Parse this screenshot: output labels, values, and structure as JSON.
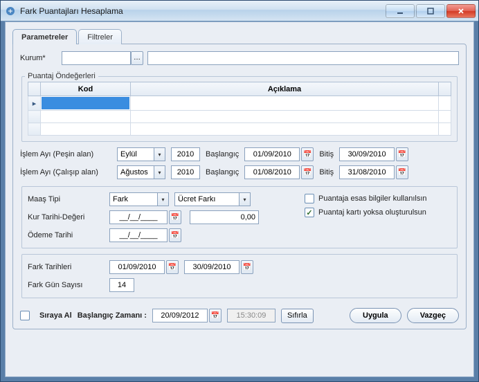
{
  "window": {
    "title": "Fark Puantajları Hesaplama"
  },
  "tabs": {
    "parametreler": "Parametreler",
    "filtreler": "Filtreler"
  },
  "kurum": {
    "label": "Kurum*",
    "code": "",
    "desc": ""
  },
  "puantaj_group": {
    "title": "Puantaj Öndeğerleri",
    "col_kod": "Kod",
    "col_aciklama": "Açıklama"
  },
  "islem": {
    "pesin_label": "İşlem Ayı (Peşin alan)",
    "calisip_label": "İşlem Ayı (Çalışıp alan)",
    "ay_pesin": "Eylül",
    "yil_pesin": "2010",
    "ay_calisip": "Ağustos",
    "yil_calisip": "2010",
    "baslangic_label": "Başlangıç",
    "bitis_label": "Bitiş",
    "pesin_baslangic": "01/09/2010",
    "pesin_bitis": "30/09/2010",
    "calisip_baslangic": "01/08/2010",
    "calisip_bitis": "31/08/2010"
  },
  "maas": {
    "tipi_label": "Maaş Tipi",
    "tipi_value": "Fark",
    "ucret_value": "Ücret Farkı",
    "kur_label": "Kur Tarihi-Değeri",
    "kur_tarih": "__/__/____",
    "kur_deger": "0,00",
    "odeme_label": "Ödeme Tarihi",
    "odeme_value": "__/__/____",
    "cb1_label": "Puantaja esas bilgiler kullanılsın",
    "cb2_label": "Puantaj kartı yoksa oluşturulsun"
  },
  "fark": {
    "tarihleri_label": "Fark Tarihleri",
    "t1": "01/09/2010",
    "t2": "30/09/2010",
    "gun_label": "Fark Gün Sayısı",
    "gun_value": "14"
  },
  "footer": {
    "siraya_label": "Sıraya Al",
    "baslangic_label": "Başlangıç Zamanı :",
    "tarih": "20/09/2012",
    "saat": "15:30:09",
    "sifirla": "Sıfırla",
    "uygula": "Uygula",
    "vazgec": "Vazgeç"
  }
}
